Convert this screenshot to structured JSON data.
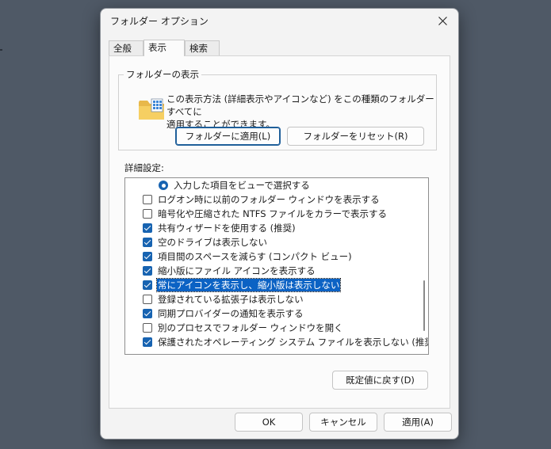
{
  "window": {
    "title": "フォルダー オプション"
  },
  "tabs": [
    {
      "label": "全般",
      "active": false
    },
    {
      "label": "表示",
      "active": true
    },
    {
      "label": "検索",
      "active": false
    }
  ],
  "folder_views": {
    "legend": "フォルダーの表示",
    "description_line1": "この表示方法 (詳細表示やアイコンなど) をこの種類のフォルダーすべてに",
    "description_line2": "適用することができます。",
    "apply_button": "フォルダーに適用(L)",
    "reset_button": "フォルダーをリセット(R)"
  },
  "advanced": {
    "label": "詳細設定:",
    "items": [
      {
        "type": "radio",
        "checked": true,
        "label": "入力した項目をビューで選択する"
      },
      {
        "type": "checkbox",
        "checked": false,
        "label": "ログオン時に以前のフォルダー ウィンドウを表示する"
      },
      {
        "type": "checkbox",
        "checked": false,
        "label": "暗号化や圧縮された NTFS ファイルをカラーで表示する"
      },
      {
        "type": "checkbox",
        "checked": true,
        "label": "共有ウィザードを使用する (推奨)"
      },
      {
        "type": "checkbox",
        "checked": true,
        "label": "空のドライブは表示しない"
      },
      {
        "type": "checkbox",
        "checked": true,
        "label": "項目間のスペースを減らす (コンパクト ビュー)"
      },
      {
        "type": "checkbox",
        "checked": true,
        "label": "縮小版にファイル アイコンを表示する"
      },
      {
        "type": "checkbox",
        "checked": true,
        "selected": true,
        "label": "常にアイコンを表示し、縮小版は表示しない"
      },
      {
        "type": "checkbox",
        "checked": false,
        "label": "登録されている拡張子は表示しない"
      },
      {
        "type": "checkbox",
        "checked": true,
        "label": "同期プロバイダーの通知を表示する"
      },
      {
        "type": "checkbox",
        "checked": false,
        "label": "別のプロセスでフォルダー ウィンドウを開く"
      },
      {
        "type": "checkbox",
        "checked": true,
        "label": "保護されたオペレーティング システム ファイルを表示しない (推奨)"
      }
    ],
    "restore_button": "既定値に戻す(D)"
  },
  "footer": {
    "ok": "OK",
    "cancel": "キャンセル",
    "apply": "適用(A)"
  },
  "colors": {
    "accent": "#1763b1",
    "selection": "#0b62c4",
    "desktop": "#4f5966"
  }
}
